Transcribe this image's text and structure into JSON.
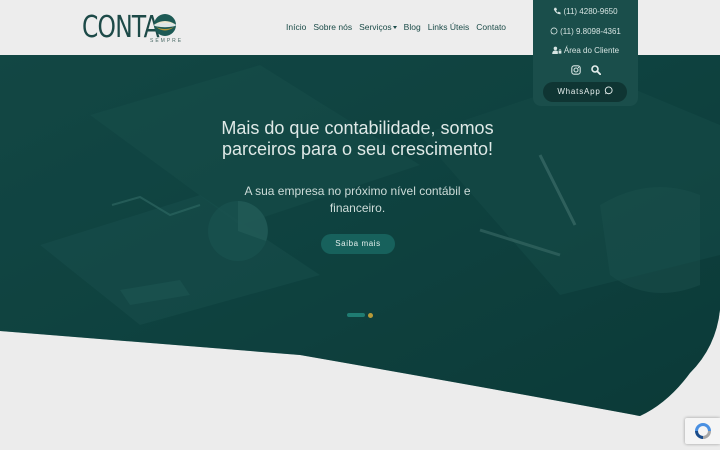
{
  "header": {
    "logo_text": "CONTA",
    "logo_sub": "SEMPRE",
    "nav": [
      {
        "label": "Início"
      },
      {
        "label": "Sobre nós"
      },
      {
        "label": "Serviços"
      },
      {
        "label": "Blog"
      },
      {
        "label": "Links Úteis"
      },
      {
        "label": "Contato"
      }
    ]
  },
  "contact": {
    "phone": "(11) 4280-9650",
    "whatsapp_number": "(11) 9.8098-4361",
    "client_area": "Área do Cliente",
    "whatsapp_button": "WhatsApp",
    "icons": [
      "phone-icon",
      "whatsapp-icon",
      "user-lock-icon",
      "instagram-icon",
      "search-icon"
    ]
  },
  "hero": {
    "title": "Mais do que contabilidade, somos parceiros para o seu crescimento!",
    "subtitle": "A sua empresa no próximo nível contábil e financeiro.",
    "button": "Saiba mais"
  },
  "colors": {
    "brand_dark": "#1a4e4b",
    "hero_overlay": "#0e4240",
    "accent_gold": "#b89a38",
    "button_teal": "#17615c"
  }
}
